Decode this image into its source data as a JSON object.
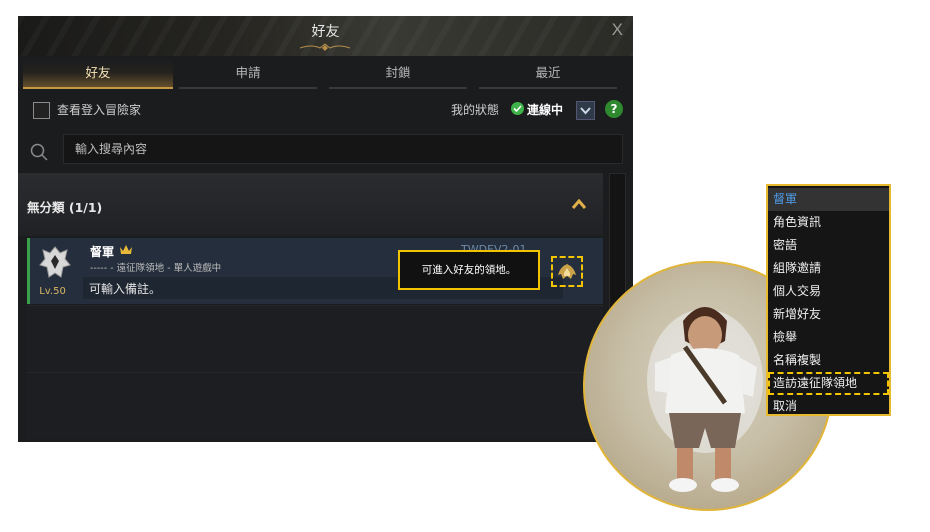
{
  "window": {
    "title": "好友",
    "close_label": "X"
  },
  "tabs": [
    {
      "label": "好友",
      "active": true
    },
    {
      "label": "申請",
      "active": false
    },
    {
      "label": "封鎖",
      "active": false
    },
    {
      "label": "最近",
      "active": false
    }
  ],
  "options": {
    "view_login_label": "查看登入冒險家",
    "status_label": "我的狀態",
    "status_value": "連線中",
    "help_label": "?"
  },
  "search": {
    "placeholder": "輸入搜尋內容"
  },
  "group": {
    "label": "無分類 (1/1)"
  },
  "friend": {
    "name": "督軍",
    "level": "Lv.50",
    "status_line": "----- - 遠征隊領地 - 單人遊戲中",
    "memo": "可輸入備註。",
    "server": "TWDEV2-01"
  },
  "tooltip": {
    "text": "可進入好友的領地。"
  },
  "context_menu": {
    "header": "督軍",
    "items": [
      {
        "label": "角色資訊"
      },
      {
        "label": "密語"
      },
      {
        "label": "組隊邀請"
      },
      {
        "label": "個人交易"
      },
      {
        "label": "新增好友"
      },
      {
        "label": "檢舉"
      },
      {
        "label": "名稱複製"
      },
      {
        "label": "造訪遠征隊領地",
        "highlighted": true
      },
      {
        "label": "取消"
      }
    ]
  },
  "colors": {
    "accent_gold": "#c59846",
    "online_green": "#3fb34a",
    "highlight_yellow": "#f2c400",
    "menu_header_blue": "#4f9be8"
  }
}
